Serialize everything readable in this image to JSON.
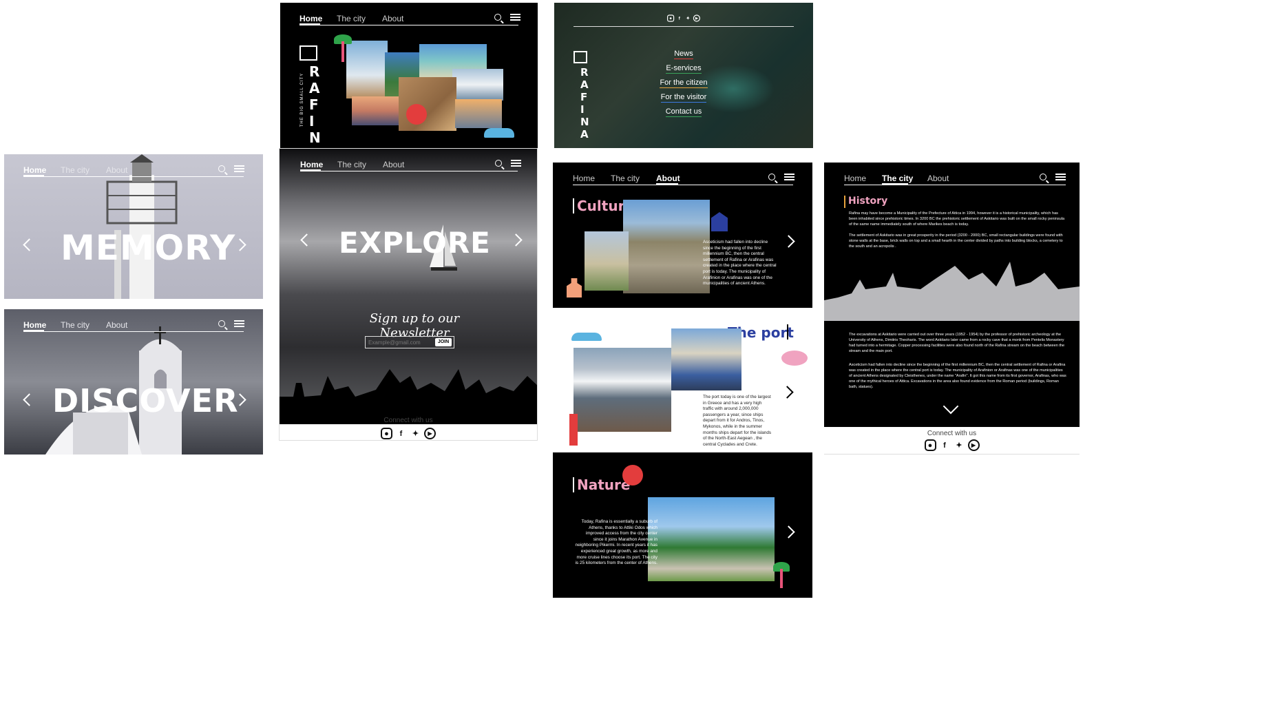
{
  "nav": {
    "home": "Home",
    "city": "The city",
    "about": "About"
  },
  "memory": {
    "word": "MEMORY"
  },
  "discover": {
    "word": "DISCOVER"
  },
  "hero": {
    "logo_line": "THE BIG SMALL CITY",
    "logo_word": "RAFINA"
  },
  "explore": {
    "word": "EXPLORE",
    "newsletter_title": "Sign up to our Newsletter",
    "email_placeholder": "Example@gmail.com",
    "join_label": "JOIN",
    "connect": "Connect with us"
  },
  "menu": {
    "items": [
      "News",
      "E-services",
      "For the citizen",
      "For the visitor",
      "Contact us"
    ],
    "underline_colors": [
      "#e33d3d",
      "#3aa35a",
      "#e8a33d",
      "#3d7be3",
      "#e33d3d"
    ]
  },
  "culture": {
    "title": "Culture",
    "text": "Asceticism had fallen into decline since the beginning of the first millennium BC, then the central settlement of Rafina or Arafinas was created in the place where the central port is today. The municipality of Arafinion or Arafinas was one of the municipalities of ancient Athens."
  },
  "port": {
    "title": "The port",
    "text": "The port today is one of the largest in Greece and has a very high traffic with around 2,000,000 passengers a year, since ships depart from it for Andros, Tinos, Mykonos, while in the summer months ships depart for the islands of the North-East Aegean , the central Cyclades and Crete."
  },
  "nature": {
    "title": "Nature",
    "text": "Today, Rafina is essentially a suburb of Athens, thanks to Attiki Odos which improved access from the city center since it joins Marathon Avenue in neighboring Pikermi. In recent years it has experienced great growth, as more and more cruise lines choose its port. The city is 25 kilometers from the center of Athens."
  },
  "history": {
    "title": "History",
    "p1": "Rafina may have become a Municipality of the Prefecture of Attica in 1994, however it is a historical municipality, which has been inhabited since prehistoric times. In 3200 BC the prehistoric settlement of Askitario was built on the small rocky peninsula of the same name immediately south of where Marikes beach is today.",
    "p2": "The settlement of Askitario was in great prosperity in the period (3200 - 2000) BC, small rectangular buildings were found with stone walls at the base, brick walls on top and a small hearth in the center divided by paths into building blocks, a cemetery to the south and an acropolis .",
    "p3": "The excavations at Askitario were carried out over three years (1952 - 1954) by the professor of prehistoric archeology at the University of Athens, Dimitris Theoharis. The word Askitario later came from a rocky cave that a monk from Pentelis Monastery had turned into a hermitage. Copper processing facilities were also found north of the Rafina stream on the beach between the stream and the main port.",
    "p4": "Asceticism had fallen into decline since the beginning of the first millennium BC, then the central settlement of Rafina or Arafina was created in the place where the central port is today. The municipality of Arafinion or Arafinas was one of the municipalities of ancient Athens designated by Cleisthenes, under the name \"Arafin\". It got this name from its first governor, Arafinas, who was one of the mythical heroes of Attica. Excavations in the area also found evidence from the Roman period (buildings, Roman bath, statues).",
    "connect": "Connect with us"
  },
  "colors": {
    "culture_pink": "#f0a3c0",
    "port_blue": "#2b3fa0",
    "accent_red": "#e33d3d",
    "wave_blue": "#5ab3e0"
  }
}
